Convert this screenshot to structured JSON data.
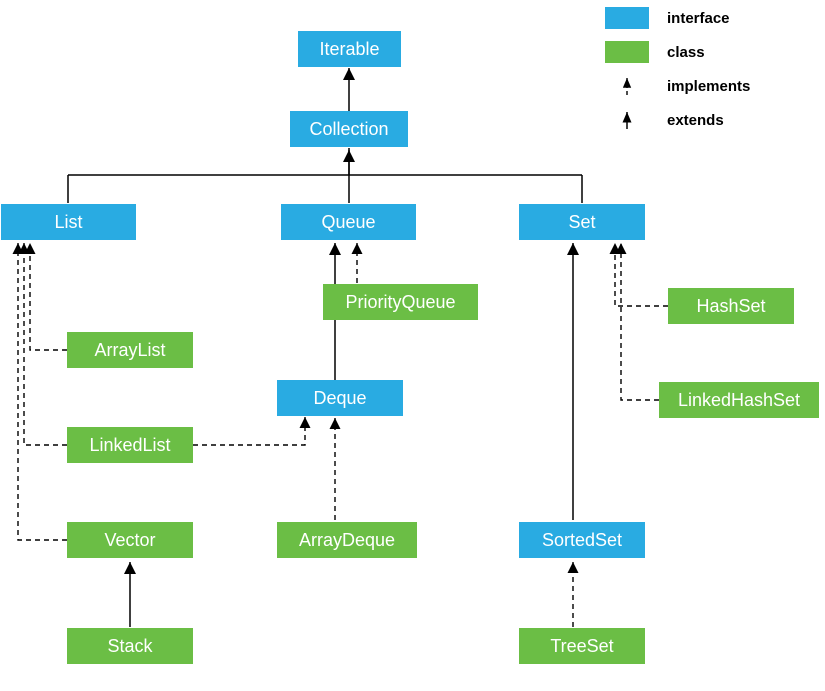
{
  "legend": {
    "interface": "interface",
    "class": "class",
    "implements": "implements",
    "extends": "extends"
  },
  "nodes": {
    "iterable": {
      "label": "Iterable",
      "type": "interface"
    },
    "collection": {
      "label": "Collection",
      "type": "interface"
    },
    "list": {
      "label": "List",
      "type": "interface"
    },
    "queue": {
      "label": "Queue",
      "type": "interface"
    },
    "set": {
      "label": "Set",
      "type": "interface"
    },
    "deque": {
      "label": "Deque",
      "type": "interface"
    },
    "sortedset": {
      "label": "SortedSet",
      "type": "interface"
    },
    "arraylist": {
      "label": "ArrayList",
      "type": "class"
    },
    "linkedlist": {
      "label": "LinkedList",
      "type": "class"
    },
    "vector": {
      "label": "Vector",
      "type": "class"
    },
    "stack": {
      "label": "Stack",
      "type": "class"
    },
    "priorityqueue": {
      "label": "PriorityQueue",
      "type": "class"
    },
    "arraydeque": {
      "label": "ArrayDeque",
      "type": "class"
    },
    "hashset": {
      "label": "HashSet",
      "type": "class"
    },
    "linkedhashset": {
      "label": "LinkedHashSet",
      "type": "class"
    },
    "treeset": {
      "label": "TreeSet",
      "type": "class"
    }
  },
  "edges": [
    {
      "from": "collection",
      "to": "iterable",
      "kind": "extends"
    },
    {
      "from": "list",
      "to": "collection",
      "kind": "extends"
    },
    {
      "from": "queue",
      "to": "collection",
      "kind": "extends"
    },
    {
      "from": "set",
      "to": "collection",
      "kind": "extends"
    },
    {
      "from": "arraylist",
      "to": "list",
      "kind": "implements"
    },
    {
      "from": "linkedlist",
      "to": "list",
      "kind": "implements"
    },
    {
      "from": "linkedlist",
      "to": "deque",
      "kind": "implements"
    },
    {
      "from": "vector",
      "to": "list",
      "kind": "implements"
    },
    {
      "from": "stack",
      "to": "vector",
      "kind": "extends"
    },
    {
      "from": "deque",
      "to": "queue",
      "kind": "extends"
    },
    {
      "from": "priorityqueue",
      "to": "queue",
      "kind": "implements"
    },
    {
      "from": "arraydeque",
      "to": "deque",
      "kind": "implements"
    },
    {
      "from": "hashset",
      "to": "set",
      "kind": "implements"
    },
    {
      "from": "linkedhashset",
      "to": "set",
      "kind": "implements"
    },
    {
      "from": "sortedset",
      "to": "set",
      "kind": "extends"
    },
    {
      "from": "treeset",
      "to": "sortedset",
      "kind": "implements"
    }
  ]
}
